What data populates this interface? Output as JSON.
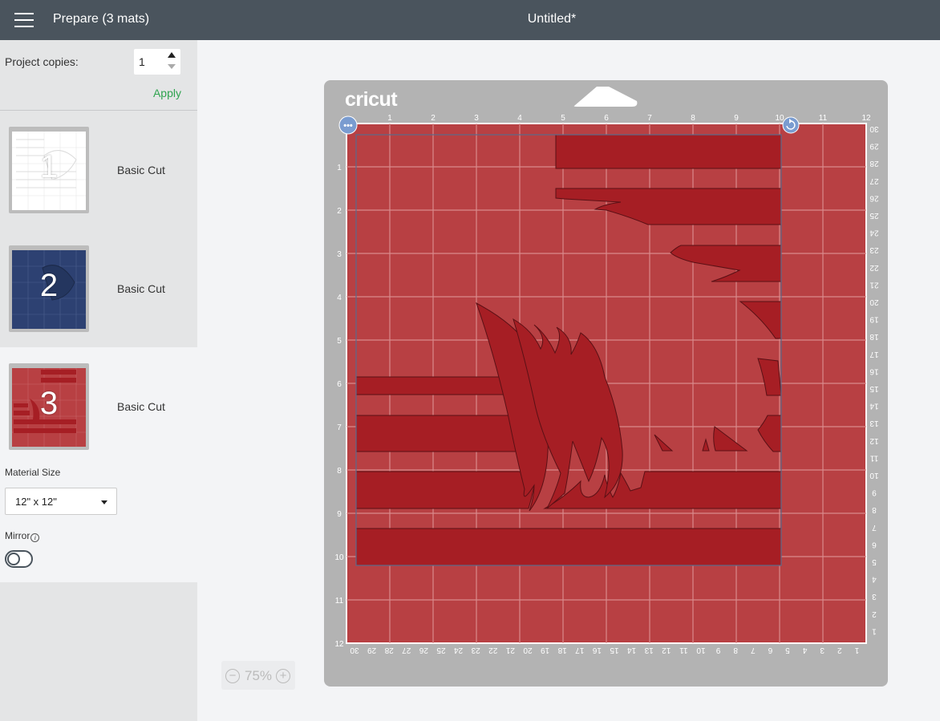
{
  "header": {
    "prepare_title": "Prepare (3 mats)",
    "document_title": "Untitled*"
  },
  "sidebar": {
    "copies_label": "Project copies:",
    "copies_value": "1",
    "apply_label": "Apply",
    "mats": [
      {
        "number": "1",
        "label": "Basic Cut",
        "color": "#ffffff"
      },
      {
        "number": "2",
        "label": "Basic Cut",
        "color": "#2d4172"
      },
      {
        "number": "3",
        "label": "Basic Cut",
        "color": "#b13a3e"
      }
    ],
    "material_size_label": "Material Size",
    "material_size_value": "12\" x 12\"",
    "mirror_label": "Mirror"
  },
  "canvas": {
    "brand": "cricut",
    "mat_color": "#b84043",
    "shape_color": "#a61e24",
    "top_ruler": [
      "1",
      "2",
      "3",
      "4",
      "5",
      "6",
      "7",
      "8",
      "9",
      "10",
      "11",
      "12"
    ],
    "left_ruler": [
      "1",
      "2",
      "3",
      "4",
      "5",
      "6",
      "7",
      "8",
      "9",
      "10",
      "11",
      "12"
    ],
    "bottom_ruler": [
      "30",
      "29",
      "28",
      "27",
      "26",
      "25",
      "24",
      "23",
      "22",
      "21",
      "20",
      "19",
      "18",
      "17",
      "16",
      "15",
      "14",
      "13",
      "12",
      "11",
      "10",
      "9",
      "8",
      "7",
      "6",
      "5",
      "4",
      "3",
      "2",
      "1"
    ],
    "right_ruler": [
      "30",
      "29",
      "28",
      "27",
      "26",
      "25",
      "24",
      "23",
      "22",
      "21",
      "20",
      "19",
      "18",
      "17",
      "16",
      "15",
      "14",
      "13",
      "12",
      "11",
      "10",
      "9",
      "8",
      "7",
      "6",
      "5",
      "4",
      "3",
      "2",
      "1"
    ],
    "zoom": "75%"
  }
}
